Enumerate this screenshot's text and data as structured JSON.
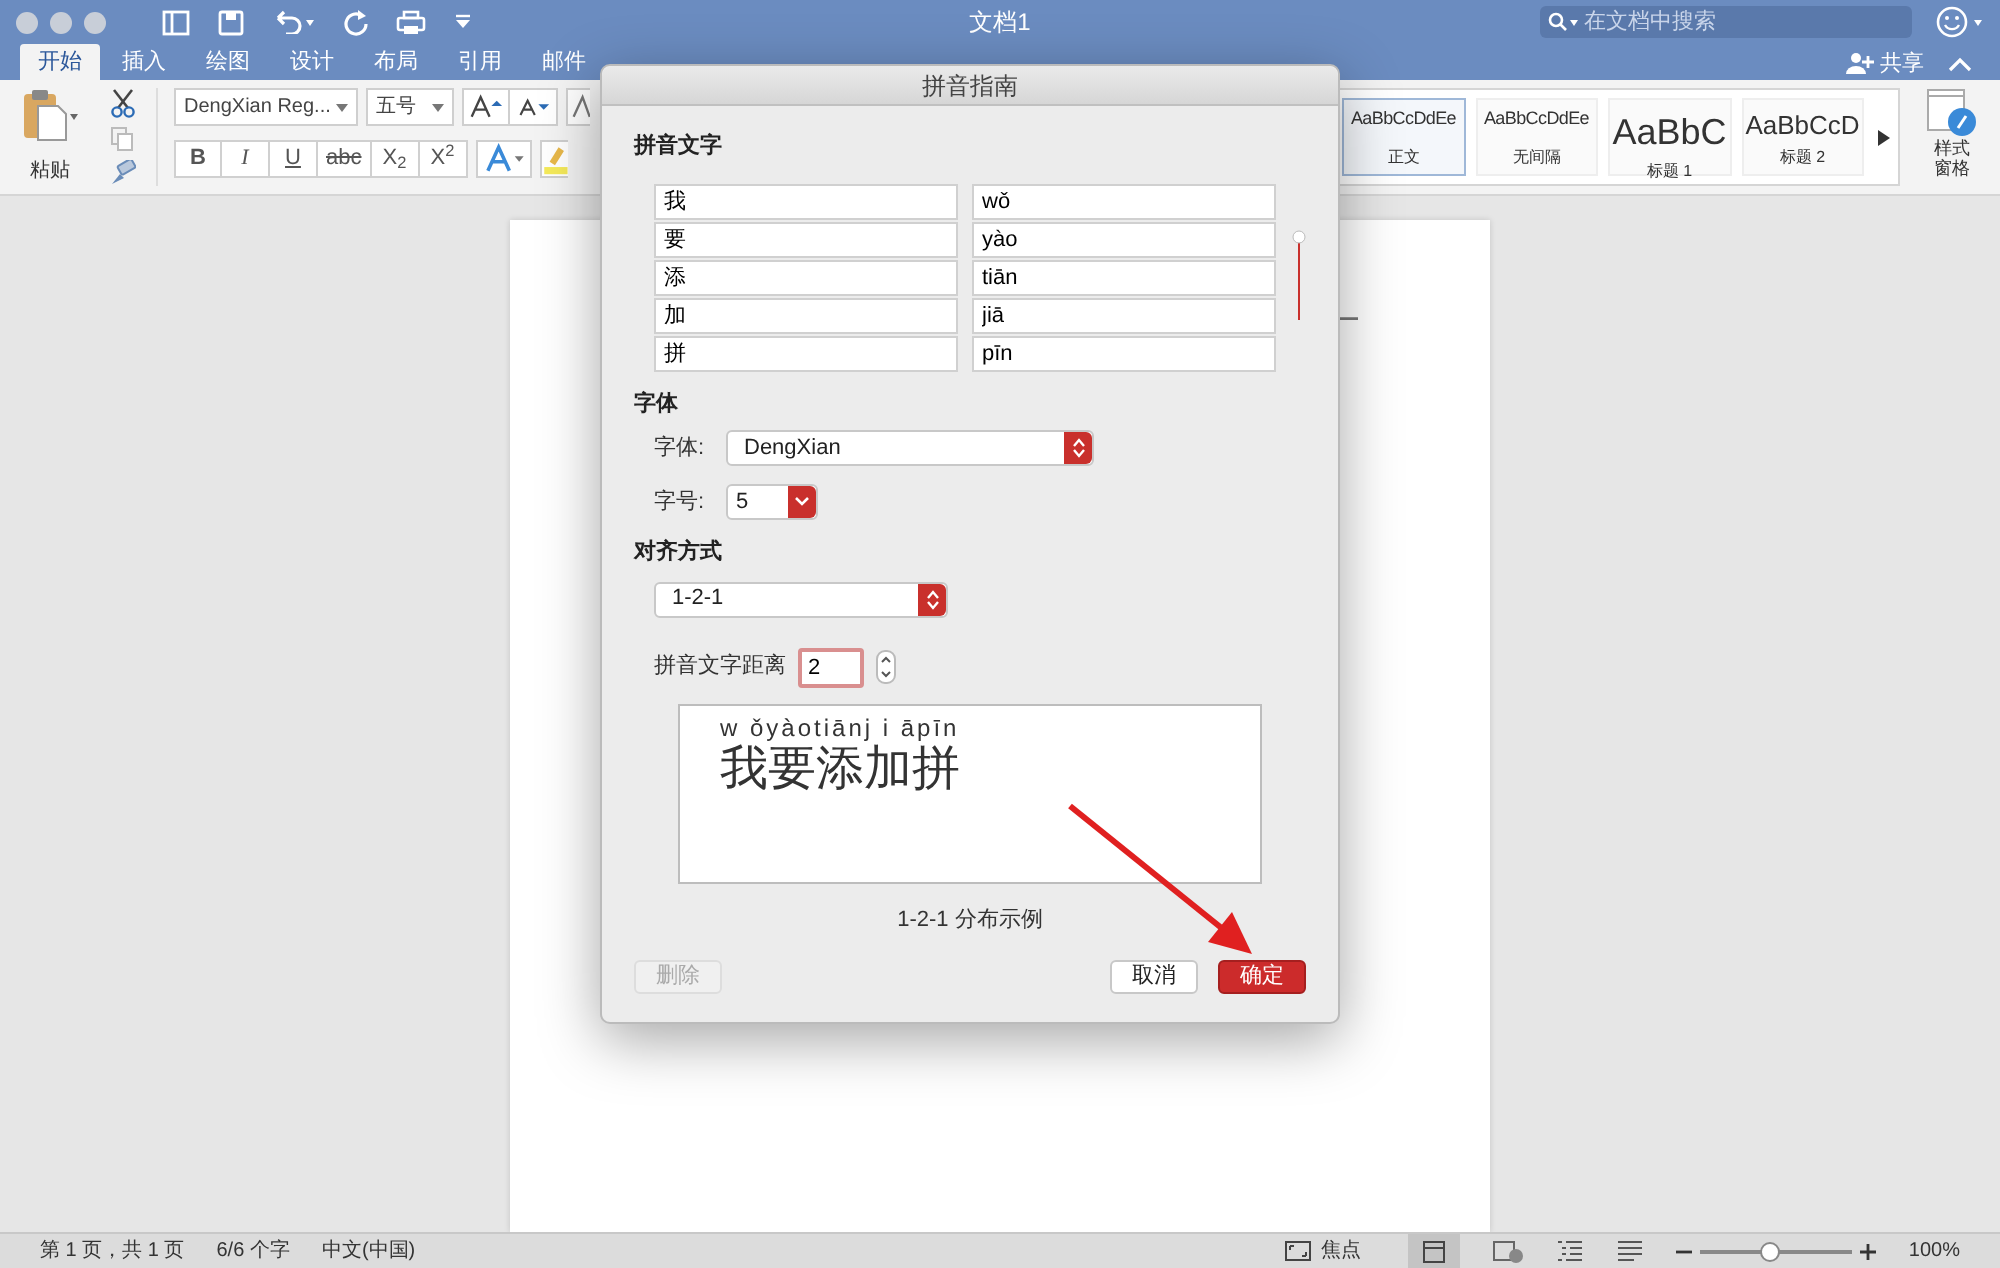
{
  "window": {
    "title": "文档1"
  },
  "search": {
    "placeholder": "在文档中搜索"
  },
  "share": {
    "label": "共享"
  },
  "tabs": [
    {
      "label": "开始",
      "selected": true
    },
    {
      "label": "插入",
      "selected": false
    },
    {
      "label": "绘图",
      "selected": false
    },
    {
      "label": "设计",
      "selected": false
    },
    {
      "label": "布局",
      "selected": false
    },
    {
      "label": "引用",
      "selected": false
    },
    {
      "label": "邮件",
      "selected": false
    }
  ],
  "ribbon": {
    "paste_label": "粘贴",
    "font": "DengXian Reg...",
    "size": "五号",
    "format_buttons": [
      {
        "label": "B",
        "kind": "bold"
      },
      {
        "label": "I",
        "kind": "italic"
      },
      {
        "label": "U",
        "kind": "underline"
      },
      {
        "label": "abc",
        "kind": "strike"
      },
      {
        "label": "X$_{2}$",
        "kind": "script"
      },
      {
        "label": "X$^{2}$",
        "kind": "script"
      }
    ],
    "styles": [
      {
        "sample": "AaBbCcDdEe",
        "name": "正文",
        "kind": "small",
        "selected": true
      },
      {
        "sample": "AaBbCcDdEe",
        "name": "无间隔",
        "kind": "small",
        "selected": false
      },
      {
        "sample": "AaBbC",
        "name": "标题 1",
        "kind": "large",
        "selected": false
      },
      {
        "sample": "AaBbCcD",
        "name": "标题 2",
        "kind": "medium",
        "selected": false
      }
    ],
    "styles_pane": "样式窗格"
  },
  "dialog": {
    "title": "拼音指南",
    "section_text": "拼音文字",
    "rows": [
      {
        "base": "我",
        "ruby": "wǒ"
      },
      {
        "base": "要",
        "ruby": "yào"
      },
      {
        "base": "添",
        "ruby": "tiān"
      },
      {
        "base": "加",
        "ruby": "jiā"
      },
      {
        "base": "拼",
        "ruby": "pīn"
      }
    ],
    "section_font": "字体",
    "font_label": "字体:",
    "font_value": "DengXian",
    "size_label": "字号:",
    "size_value": "5",
    "section_align": "对齐方式",
    "align_value": "1-2-1",
    "offset_label": "拼音文字距离",
    "offset_value": "2",
    "preview_ruby": "w ǒyàotiānj i āpīn",
    "preview_text": "我要添加拼",
    "preview_caption": "1-2-1 分布示例",
    "buttons": [
      {
        "label": "删除",
        "kind": "plain",
        "disabled": true
      },
      {
        "label": "取消",
        "kind": "plain",
        "disabled": false
      },
      {
        "label": "确定",
        "kind": "default",
        "disabled": false
      }
    ]
  },
  "status_bar": {
    "page": "第 1 页，共 1 页",
    "words": "6/6 个字",
    "language": "中文(中国)",
    "focus": "焦点",
    "zoom": {
      "level": 0.45,
      "reading": "100%"
    }
  }
}
